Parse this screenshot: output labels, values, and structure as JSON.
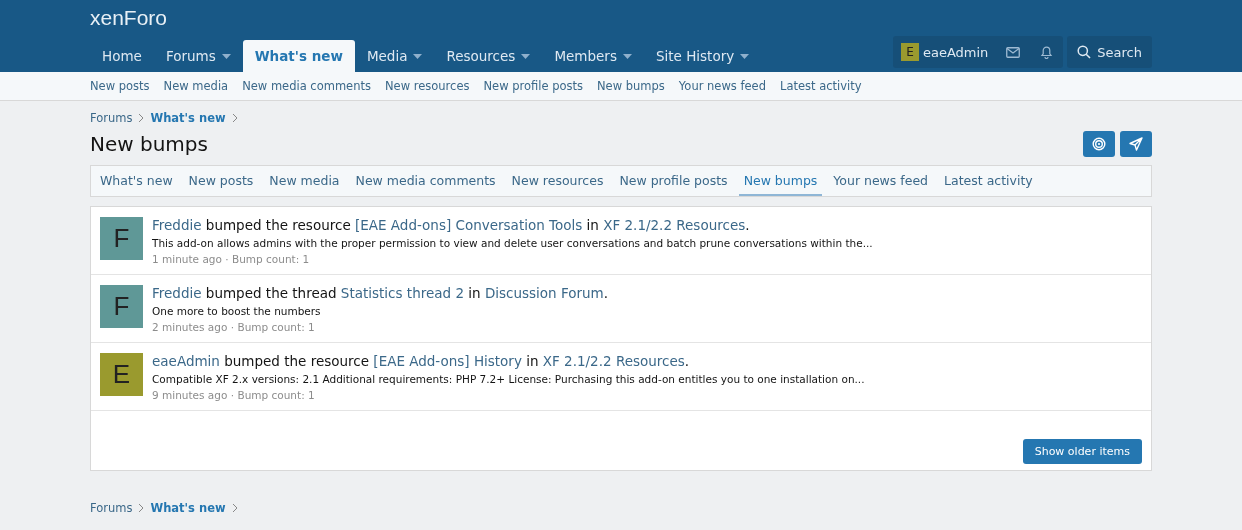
{
  "logo": "xenForo",
  "nav": [
    {
      "label": "Home",
      "menu": false,
      "selected": false
    },
    {
      "label": "Forums",
      "menu": true,
      "selected": false
    },
    {
      "label": "What's new",
      "menu": false,
      "selected": true
    },
    {
      "label": "Media",
      "menu": true,
      "selected": false
    },
    {
      "label": "Resources",
      "menu": true,
      "selected": false
    },
    {
      "label": "Members",
      "menu": true,
      "selected": false
    },
    {
      "label": "Site History",
      "menu": true,
      "selected": false
    }
  ],
  "user": {
    "initial": "E",
    "name": "eaeAdmin",
    "color": "#9a9a2e"
  },
  "search": "Search",
  "subnav": [
    "New posts",
    "New media",
    "New media comments",
    "New resources",
    "New profile posts",
    "New bumps",
    "Your news feed",
    "Latest activity"
  ],
  "breadcrumb": [
    {
      "label": "Forums",
      "current": false
    },
    {
      "label": "What's new",
      "current": true
    }
  ],
  "title": "New bumps",
  "tabs": [
    {
      "label": "What's new",
      "selected": false
    },
    {
      "label": "New posts",
      "selected": false
    },
    {
      "label": "New media",
      "selected": false
    },
    {
      "label": "New media comments",
      "selected": false
    },
    {
      "label": "New resources",
      "selected": false
    },
    {
      "label": "New profile posts",
      "selected": false
    },
    {
      "label": "New bumps",
      "selected": true
    },
    {
      "label": "Your news feed",
      "selected": false
    },
    {
      "label": "Latest activity",
      "selected": false
    }
  ],
  "items": [
    {
      "initial": "F",
      "color": "#5f9897",
      "parts": [
        {
          "kind": "link",
          "text": "Freddie"
        },
        {
          "kind": "text",
          "text": " bumped the resource "
        },
        {
          "kind": "link",
          "text": "[EAE Add-ons] Conversation Tools"
        },
        {
          "kind": "text",
          "text": " in "
        },
        {
          "kind": "link",
          "text": "XF 2.1/2.2 Resources"
        },
        {
          "kind": "text",
          "text": "."
        }
      ],
      "snippet": "This add-on allows admins with the proper permission to view and delete user conversations and batch prune conversations within the...",
      "time": "1 minute ago",
      "sep": "·",
      "count": "Bump count: 1"
    },
    {
      "initial": "F",
      "color": "#5f9897",
      "parts": [
        {
          "kind": "link",
          "text": "Freddie"
        },
        {
          "kind": "text",
          "text": " bumped the thread "
        },
        {
          "kind": "link",
          "text": "Statistics thread 2"
        },
        {
          "kind": "text",
          "text": " in "
        },
        {
          "kind": "link",
          "text": "Discussion Forum"
        },
        {
          "kind": "text",
          "text": "."
        }
      ],
      "snippet": "One more to boost the numbers",
      "time": "2 minutes ago",
      "sep": "·",
      "count": "Bump count: 1"
    },
    {
      "initial": "E",
      "color": "#9a9a2e",
      "parts": [
        {
          "kind": "link",
          "text": "eaeAdmin"
        },
        {
          "kind": "text",
          "text": " bumped the resource "
        },
        {
          "kind": "link",
          "text": "[EAE Add-ons] History"
        },
        {
          "kind": "text",
          "text": " in "
        },
        {
          "kind": "link",
          "text": "XF 2.1/2.2 Resources"
        },
        {
          "kind": "text",
          "text": "."
        }
      ],
      "snippet": "Compatible XF 2.x versions: 2.1 Additional requirements: PHP 7.2+ License: Purchasing this add-on entitles you to one installation on...",
      "time": "9 minutes ago",
      "sep": "·",
      "count": "Bump count: 1"
    }
  ],
  "more": "Show older items",
  "footer_breadcrumb": [
    {
      "label": "Forums",
      "current": false
    },
    {
      "label": "What's new",
      "current": true
    }
  ]
}
